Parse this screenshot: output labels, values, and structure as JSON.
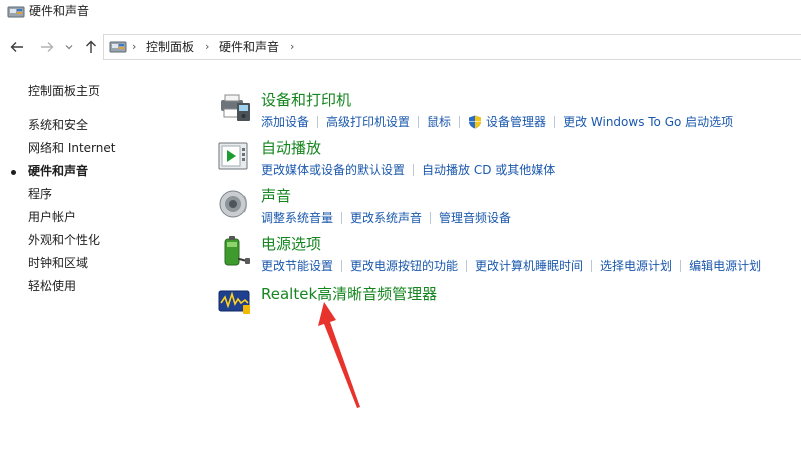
{
  "window": {
    "title": "硬件和声音",
    "icon": "control-panel-icon"
  },
  "address": {
    "icon": "control-panel-icon",
    "crumbs": [
      "控制面板",
      "硬件和声音"
    ]
  },
  "nav": {
    "back": "arrow-left-icon",
    "forward": "arrow-right-icon",
    "recent": "chevron-down-icon",
    "up": "arrow-up-icon"
  },
  "sidebar": {
    "items": [
      {
        "label": "控制面板主页"
      },
      {
        "label": "系统和安全"
      },
      {
        "label": "网络和 Internet"
      },
      {
        "label": "硬件和声音",
        "active": true
      },
      {
        "label": "程序"
      },
      {
        "label": "用户帐户"
      },
      {
        "label": "外观和个性化"
      },
      {
        "label": "时钟和区域"
      },
      {
        "label": "轻松使用"
      }
    ]
  },
  "categories": [
    {
      "title": "设备和打印机",
      "icon": "printer-icon",
      "links": [
        "添加设备",
        "高级打印机设置",
        "鼠标",
        "设备管理器",
        "更改 Windows To Go 启动选项"
      ]
    },
    {
      "title": "自动播放",
      "icon": "autoplay-icon",
      "links": [
        "更改媒体或设备的默认设置",
        "自动播放 CD 或其他媒体"
      ]
    },
    {
      "title": "声音",
      "icon": "speaker-icon",
      "links": [
        "调整系统音量",
        "更改系统声音",
        "管理音频设备"
      ]
    },
    {
      "title": "电源选项",
      "icon": "battery-icon",
      "links": [
        "更改节能设置",
        "更改电源按钮的功能",
        "更改计算机睡眠时间",
        "选择电源计划",
        "编辑电源计划"
      ]
    },
    {
      "title": "Realtek高清晰音频管理器",
      "icon": "realtek-audio-icon",
      "links": []
    }
  ],
  "colors": {
    "category_title": "#15851f",
    "link": "#1a58ad",
    "annotation_arrow": "#e8322c"
  }
}
